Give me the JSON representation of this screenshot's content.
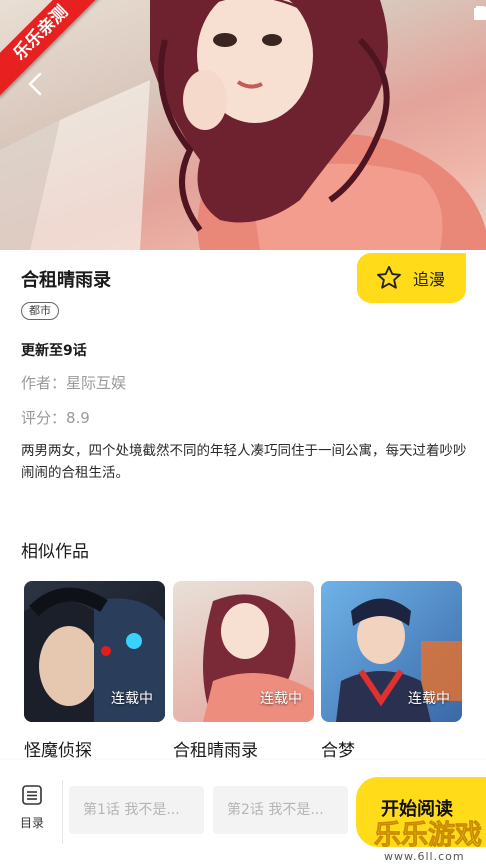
{
  "watermark_ribbon": "乐乐亲测",
  "detail": {
    "title": "合租晴雨录",
    "follow_label": "追漫",
    "tag": "都市",
    "update": "更新至9话",
    "author": "作者：星际互娱",
    "score": "评分：8.9",
    "description": "两男两女，四个处境截然不同的年轻人凑巧同住于一间公寓，每天过着吵吵闹闹的合租生活。"
  },
  "similar": {
    "heading": "相似作品",
    "items": [
      {
        "name": "怪魔侦探",
        "status": "连载中"
      },
      {
        "name": "合租晴雨录",
        "status": "连载中"
      },
      {
        "name": "合梦",
        "status": "连载中"
      }
    ]
  },
  "bottom": {
    "toc_label": "目录",
    "chapters": [
      "第1话 我不是...",
      "第2话 我不是..."
    ],
    "read_label": "开始阅读"
  },
  "watermark_logo": {
    "text": "乐乐游戏",
    "url": "www.6ll.com"
  },
  "colors": {
    "accent": "#ffdb1a",
    "ribbon": "#e8201f"
  }
}
